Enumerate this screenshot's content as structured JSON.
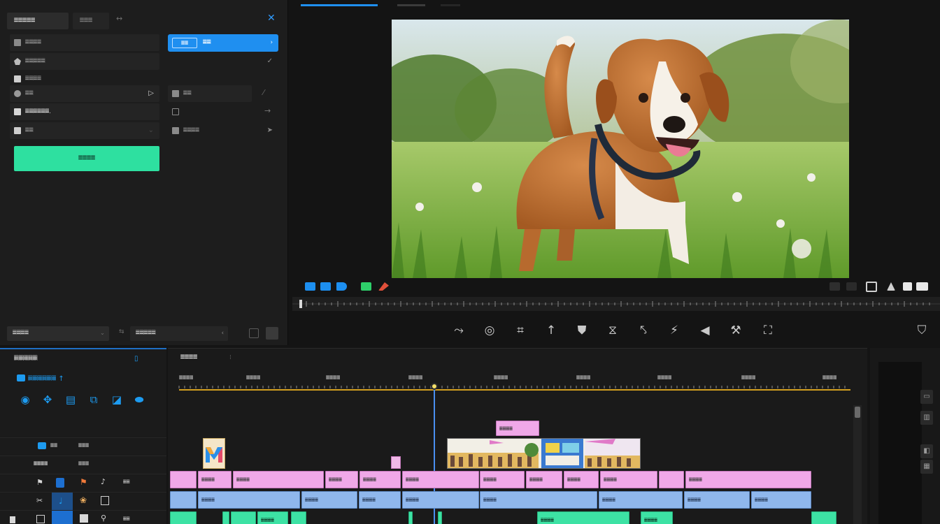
{
  "left_panel": {
    "tab_active": "𝄜𝄜𝄜𝄜𝄜",
    "tab_2": "𝄜𝄜𝄜",
    "rows": [
      {
        "label": "𝄜𝄜𝄜𝄜"
      },
      {
        "label": "𝄜𝄜𝄜𝄜𝄜"
      },
      {
        "label": "𝄜𝄜𝄜𝄜"
      },
      {
        "label": "𝄜𝄜"
      },
      {
        "label": "𝄜𝄜𝄜𝄜𝄜𝄜."
      },
      {
        "label": "𝄜𝄜"
      }
    ],
    "right_rows": [
      {
        "label": "𝄜𝄜"
      },
      {
        "label": ""
      },
      {
        "label": "𝄜𝄜𝄜𝄜"
      }
    ],
    "blue_button": {
      "inner": "𝄜𝄜",
      "label": "𝄜𝄜"
    },
    "green_button": "𝄜𝄜𝄜𝄜",
    "bottom_left": "𝄜𝄜𝄜𝄜",
    "bottom_right": "𝄜𝄜𝄜𝄜𝄜"
  },
  "timeline": {
    "panel_title": "𝄜𝄜𝄜𝄜𝄜",
    "subtitle": "𝄜𝄜𝄜𝄜𝄜𝄜",
    "main_title": "𝄜𝄜𝄜𝄜",
    "ruler_labels": [
      "𝄜𝄜𝄜𝄜",
      "𝄜𝄜𝄜𝄜",
      "𝄜𝄜𝄜𝄜",
      "𝄜𝄜𝄜𝄜",
      "𝄜𝄜𝄜𝄜",
      "𝄜𝄜𝄜𝄜",
      "𝄜𝄜𝄜𝄜",
      "𝄜𝄜𝄜𝄜",
      "𝄜𝄜𝄜𝄜"
    ],
    "tracks": [
      {
        "name": "𝄜𝄜",
        "value": "𝄜𝄜𝄜"
      },
      {
        "name": "𝄜𝄜𝄜𝄜",
        "value": "𝄜𝄜𝄜"
      },
      {
        "name": "",
        "value": "𝄜𝄜"
      },
      {
        "name": "",
        "value": ""
      },
      {
        "name": "",
        "value": "𝄜𝄜"
      }
    ],
    "clip_label": "𝄜𝄜𝄜𝄜"
  },
  "colors": {
    "accent": "#1f8ff0",
    "green": "#2ee0a0",
    "pink": "#f0a8e8",
    "blue_clip": "#8fb7ec"
  }
}
